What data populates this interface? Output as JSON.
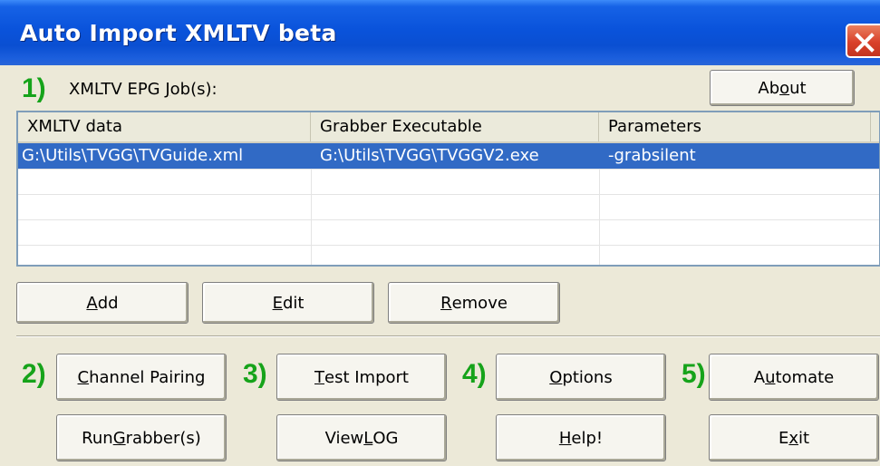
{
  "window": {
    "title": "Auto Import XMLTV beta"
  },
  "steps": {
    "one": "1)",
    "two": "2)",
    "three": "3)",
    "four": "4)",
    "five": "5)"
  },
  "jobs_label": {
    "pre": "XMLTV EPG ",
    "accel": "J",
    "post": "ob(s):"
  },
  "about_button": {
    "pre": "Ab",
    "accel": "o",
    "post": "ut"
  },
  "table": {
    "columns": [
      "XMLTV data",
      "Grabber Executable",
      "Parameters"
    ],
    "rows": [
      {
        "xmltv_data": "G:\\Utils\\TVGG\\TVGuide.xml",
        "grabber": "G:\\Utils\\TVGG\\TVGGV2.exe",
        "parameters": "-grabsilent",
        "selected": true
      }
    ]
  },
  "buttons": {
    "add": {
      "pre": "",
      "accel": "A",
      "post": "dd"
    },
    "edit": {
      "pre": "",
      "accel": "E",
      "post": "dit"
    },
    "remove": {
      "pre": "",
      "accel": "R",
      "post": "emove"
    },
    "channel_pairing": {
      "pre": "",
      "accel": "C",
      "post": "hannel Pairing"
    },
    "test_import": {
      "pre": "",
      "accel": "T",
      "post": "est Import"
    },
    "options": {
      "pre": "",
      "accel": "O",
      "post": "ptions"
    },
    "automate": {
      "pre": "A",
      "accel": "u",
      "post": "tomate"
    },
    "run_grabbers": {
      "pre": "Run ",
      "accel": "G",
      "post": "rabber(s)"
    },
    "view_log": {
      "pre": "View ",
      "accel": "L",
      "post": "OG"
    },
    "help": {
      "pre": "",
      "accel": "H",
      "post": "elp!"
    },
    "exit": {
      "pre": "E",
      "accel": "x",
      "post": "it"
    }
  },
  "colors": {
    "step_number": "#16a31a",
    "selection": "#316ac5",
    "titlebar": "#0a53db",
    "close_button": "#d9412a"
  },
  "icons": {
    "close": "close-icon"
  }
}
